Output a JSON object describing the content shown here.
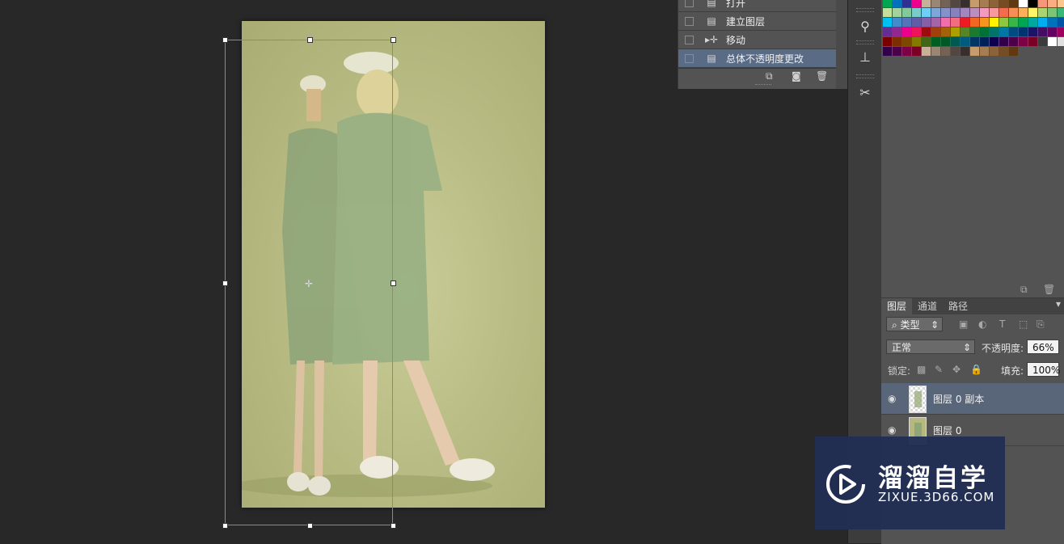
{
  "history": {
    "items": [
      {
        "label": "打开",
        "icon": "document-icon"
      },
      {
        "label": "建立图层",
        "icon": "document-icon"
      },
      {
        "label": "移动",
        "icon": "move-icon"
      },
      {
        "label": "总体不透明度更改",
        "icon": "document-icon",
        "selected": true
      }
    ],
    "toolbar_icons": [
      "new-document-from-state-icon",
      "camera-snapshot-icon",
      "trash-icon"
    ]
  },
  "layers_panel": {
    "tabs": [
      {
        "label": "图层",
        "active": true
      },
      {
        "label": "通道",
        "active": false
      },
      {
        "label": "路径",
        "active": false
      }
    ],
    "filter_label": "类型",
    "blend_mode": "正常",
    "opacity_label": "不透明度:",
    "opacity_value": "66%",
    "lock_label": "锁定:",
    "fill_label": "填充:",
    "fill_value": "100%",
    "layers": [
      {
        "name": "图层 0 副本",
        "selected": true,
        "visible": true
      },
      {
        "name": "图层 0",
        "selected": false,
        "visible": true
      }
    ]
  },
  "watermark": {
    "title": "溜溜自学",
    "subtitle": "ZIXUE.3D66.COM"
  },
  "colors": {
    "panel_bg": "#535353",
    "workspace_bg": "#282828",
    "selection": "#596578",
    "photo_bg": "#b9bd85",
    "watermark_bg": "#212f54"
  }
}
